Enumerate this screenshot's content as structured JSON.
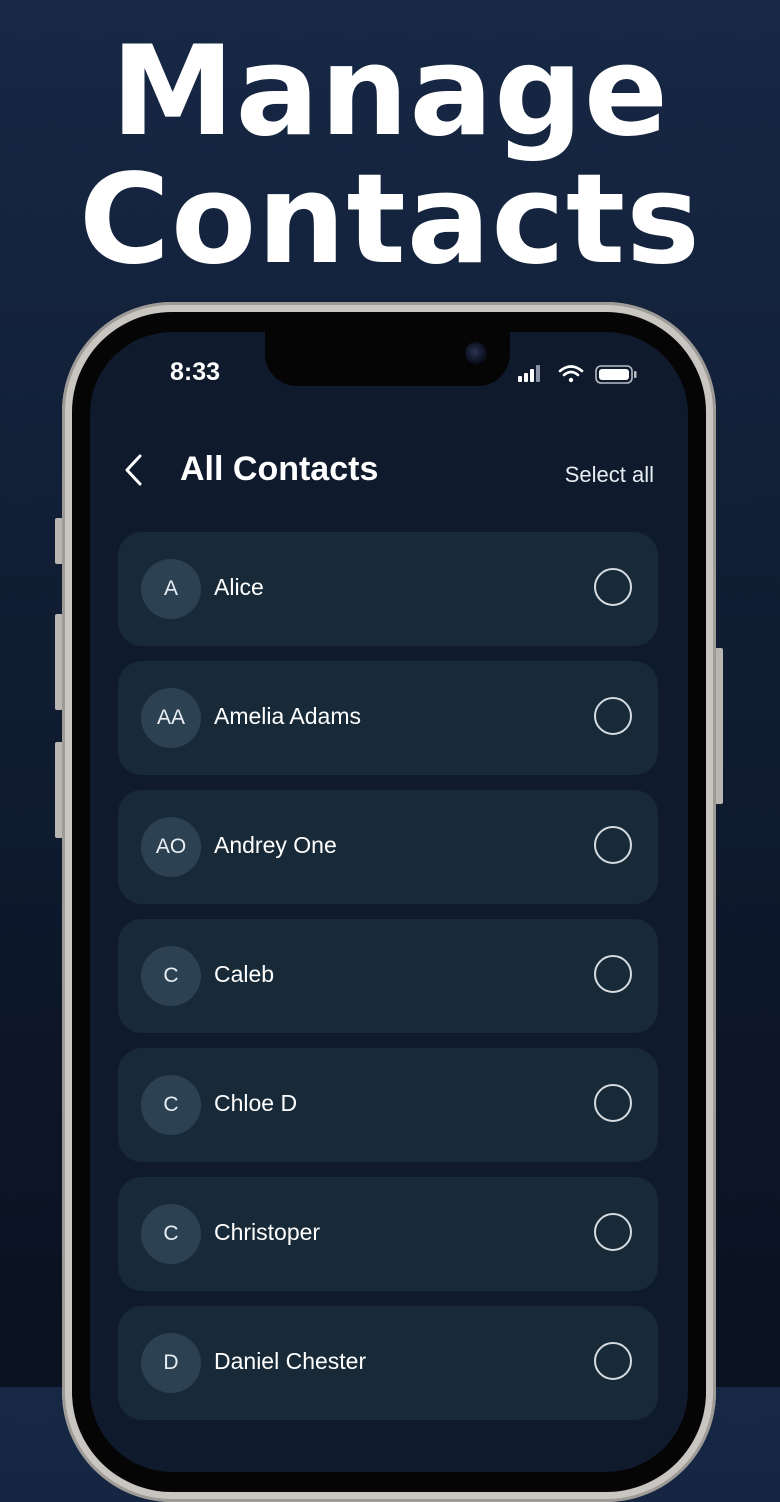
{
  "headline": {
    "line1": "Manage",
    "line2": "Contacts"
  },
  "status_bar": {
    "time": "8:33",
    "icons": [
      "signal-icon",
      "wifi-icon",
      "battery-icon"
    ]
  },
  "header": {
    "title": "All Contacts",
    "select_all_label": "Select all",
    "back_icon": "chevron-left-icon"
  },
  "contacts": [
    {
      "initials": "A",
      "name": "Alice"
    },
    {
      "initials": "AA",
      "name": "Amelia Adams"
    },
    {
      "initials": "AO",
      "name": "Andrey One"
    },
    {
      "initials": "C",
      "name": "Caleb"
    },
    {
      "initials": "C",
      "name": "Chloe D"
    },
    {
      "initials": "C",
      "name": "Christoper"
    },
    {
      "initials": "D",
      "name": "Daniel Chester"
    }
  ],
  "colors": {
    "background": "#101d33",
    "screen": "#0f1a2c",
    "card": "#182a38",
    "avatar": "#2c4152",
    "text": "#ffffff"
  }
}
